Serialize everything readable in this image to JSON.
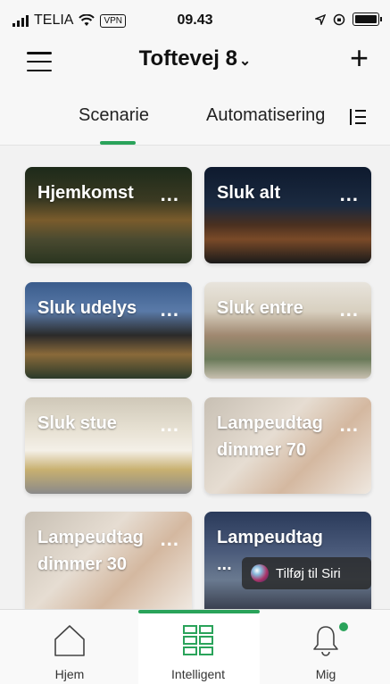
{
  "status_bar": {
    "carrier": "TELIA",
    "vpn": "VPN",
    "time": "09.43"
  },
  "header": {
    "home_name": "Toftevej 8",
    "tabs": [
      {
        "label": "Scenarie",
        "active": true
      },
      {
        "label": "Automatisering",
        "active": false
      }
    ]
  },
  "scenes": [
    {
      "label": "Hjemkomst",
      "image": "house-evening"
    },
    {
      "label": "Sluk alt",
      "image": "house-night"
    },
    {
      "label": "Sluk udelys",
      "image": "modern-house-dusk"
    },
    {
      "label": "Sluk entre",
      "image": "family-tablet"
    },
    {
      "label": "Sluk stue",
      "image": "living-room"
    },
    {
      "label": "Lampeudtag dimmer 70",
      "image": "kids-window"
    },
    {
      "label": "Lampeudtag dimmer 30",
      "image": "kids-window"
    },
    {
      "label": "Lampeudtag ...",
      "image": "building-facade"
    }
  ],
  "more_label": "...",
  "siri": {
    "label": "Tilføj til Siri"
  },
  "bottom_nav": [
    {
      "label": "Hjem",
      "icon": "house-icon",
      "active": false
    },
    {
      "label": "Intelligent",
      "icon": "grid-icon",
      "active": true
    },
    {
      "label": "Mig",
      "icon": "bell-icon",
      "active": false
    }
  ],
  "colors": {
    "accent": "#2aa35a"
  }
}
